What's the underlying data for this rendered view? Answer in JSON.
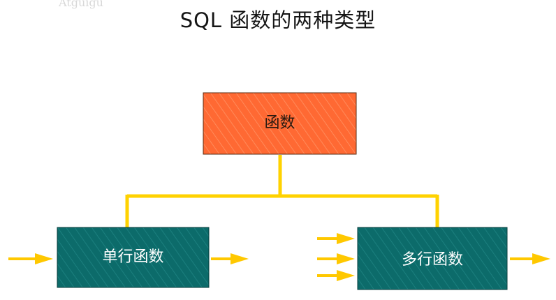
{
  "watermark": "Atguigu",
  "title": "SQL 函数的两种类型",
  "root": {
    "label": "函数"
  },
  "children": [
    {
      "label": "单行函数",
      "inputs": 1,
      "outputs": 1
    },
    {
      "label": "多行函数",
      "inputs": 3,
      "outputs": 1
    }
  ],
  "colors": {
    "root_fill": "#ff6933",
    "child_fill": "#0c6b6a",
    "connector": "#ffd200",
    "arrow": "#ffc800"
  }
}
